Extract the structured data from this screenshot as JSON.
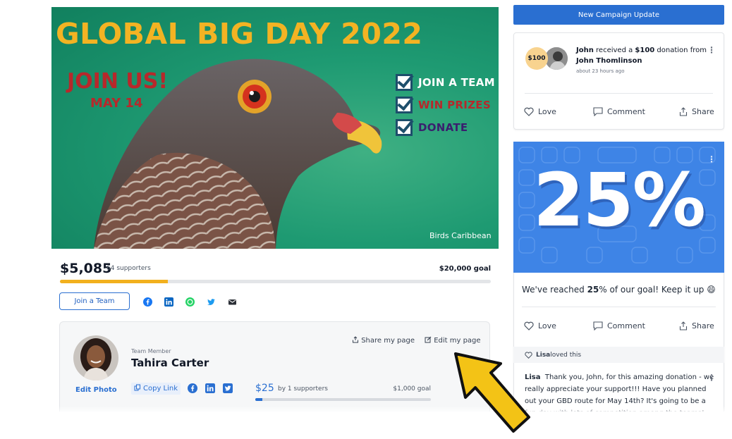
{
  "hero": {
    "title": "GLOBAL BIG DAY 2022",
    "join": "JOIN US!",
    "date": "MAY 14",
    "list": [
      {
        "label": "JOIN A TEAM",
        "color": "#ffffff"
      },
      {
        "label": "WIN PRIZES",
        "color": "#b7282b"
      },
      {
        "label": "DONATE",
        "color": "#3a1f6e"
      }
    ],
    "logo_text": "Birds Caribbean"
  },
  "campaign": {
    "raised": "$5,085",
    "supporters": "64 supporters",
    "goal": "$20,000 goal",
    "progress_fraction": 0.25
  },
  "actions": {
    "join_team": "Join a Team",
    "share_icons": [
      "facebook-icon",
      "linkedin-icon",
      "whatsapp-icon",
      "twitter-icon",
      "email-icon"
    ]
  },
  "member": {
    "role": "Team Member",
    "name": "Tahira Carter",
    "edit_photo": "Edit Photo",
    "share_page": "Share my page",
    "edit_page": "Edit my page",
    "copy_link": "Copy Link",
    "amount": "$25",
    "by": "by 1 supporters",
    "goal": "$1,000 goal",
    "progress_fraction": 0.025
  },
  "sidebar": {
    "new_update": "New Campaign Update",
    "donation": {
      "badge": "$100",
      "donor": "John",
      "received_text": " received a ",
      "amount": "$100",
      "donation_from": " donation from",
      "from": "John Thomlinson",
      "time": "about 23 hours ago"
    },
    "love": "Love",
    "comment": "Comment",
    "share": "Share",
    "milestone": {
      "percent": "25%",
      "text_before": "We've reached ",
      "text_bold": "25",
      "text_after": "% of our goal! Keep it up 😄"
    },
    "loved_by": "Lisa",
    "loved_text": " loved this",
    "comment_author": "Lisa",
    "comment_body": "Thank you, John, for this amazing donation - we really appreciate your support!!! Have you planned out your GBD route for May 14th? It's going to be a fun day with lots of competition among the teams!"
  },
  "colors": {
    "accent": "#2a6fd1",
    "progress": "#f2b01e",
    "title_yellow": "#f3b323",
    "hero_red": "#b7282b"
  }
}
